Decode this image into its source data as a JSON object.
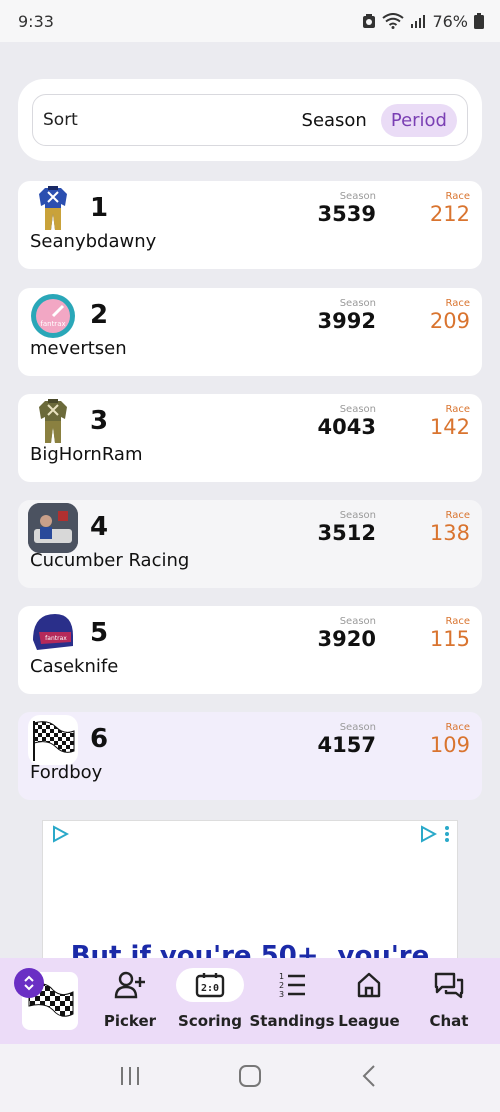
{
  "status": {
    "time": "9:33",
    "battery": "76%"
  },
  "sort": {
    "label": "Sort",
    "options": [
      "Season",
      "Period"
    ],
    "active": "Period"
  },
  "stat_labels": {
    "season": "Season",
    "race": "Race"
  },
  "standings": [
    {
      "rank": "1",
      "name": "Seanybdawny",
      "season": "3539",
      "race": "212",
      "avatar": "suit-blue-icon"
    },
    {
      "rank": "2",
      "name": "mevertsen",
      "season": "3992",
      "race": "209",
      "avatar": "gauge-icon"
    },
    {
      "rank": "3",
      "name": "BigHornRam",
      "season": "4043",
      "race": "142",
      "avatar": "suit-green-icon"
    },
    {
      "rank": "4",
      "name": "Cucumber Racing",
      "season": "3512",
      "race": "138",
      "avatar": "photo-icon"
    },
    {
      "rank": "5",
      "name": "Caseknife",
      "season": "3920",
      "race": "115",
      "avatar": "helmet-icon"
    },
    {
      "rank": "6",
      "name": "Fordboy",
      "season": "4157",
      "race": "109",
      "avatar": "checkered-flag-icon"
    }
  ],
  "ad": {
    "text": "But if you're 50+, you're"
  },
  "nav": {
    "items": [
      {
        "label": "Picker",
        "icon": "add-person-icon"
      },
      {
        "label": "Scoring",
        "icon": "scoreboard-icon"
      },
      {
        "label": "Standings",
        "icon": "ranked-list-icon"
      },
      {
        "label": "League",
        "icon": "home-icon"
      },
      {
        "label": "Chat",
        "icon": "chat-icon"
      }
    ],
    "active": "Scoring"
  },
  "colors": {
    "accent": "#7a3fb3",
    "race": "#d9742f",
    "nav_bg": "#ecdcf8"
  }
}
